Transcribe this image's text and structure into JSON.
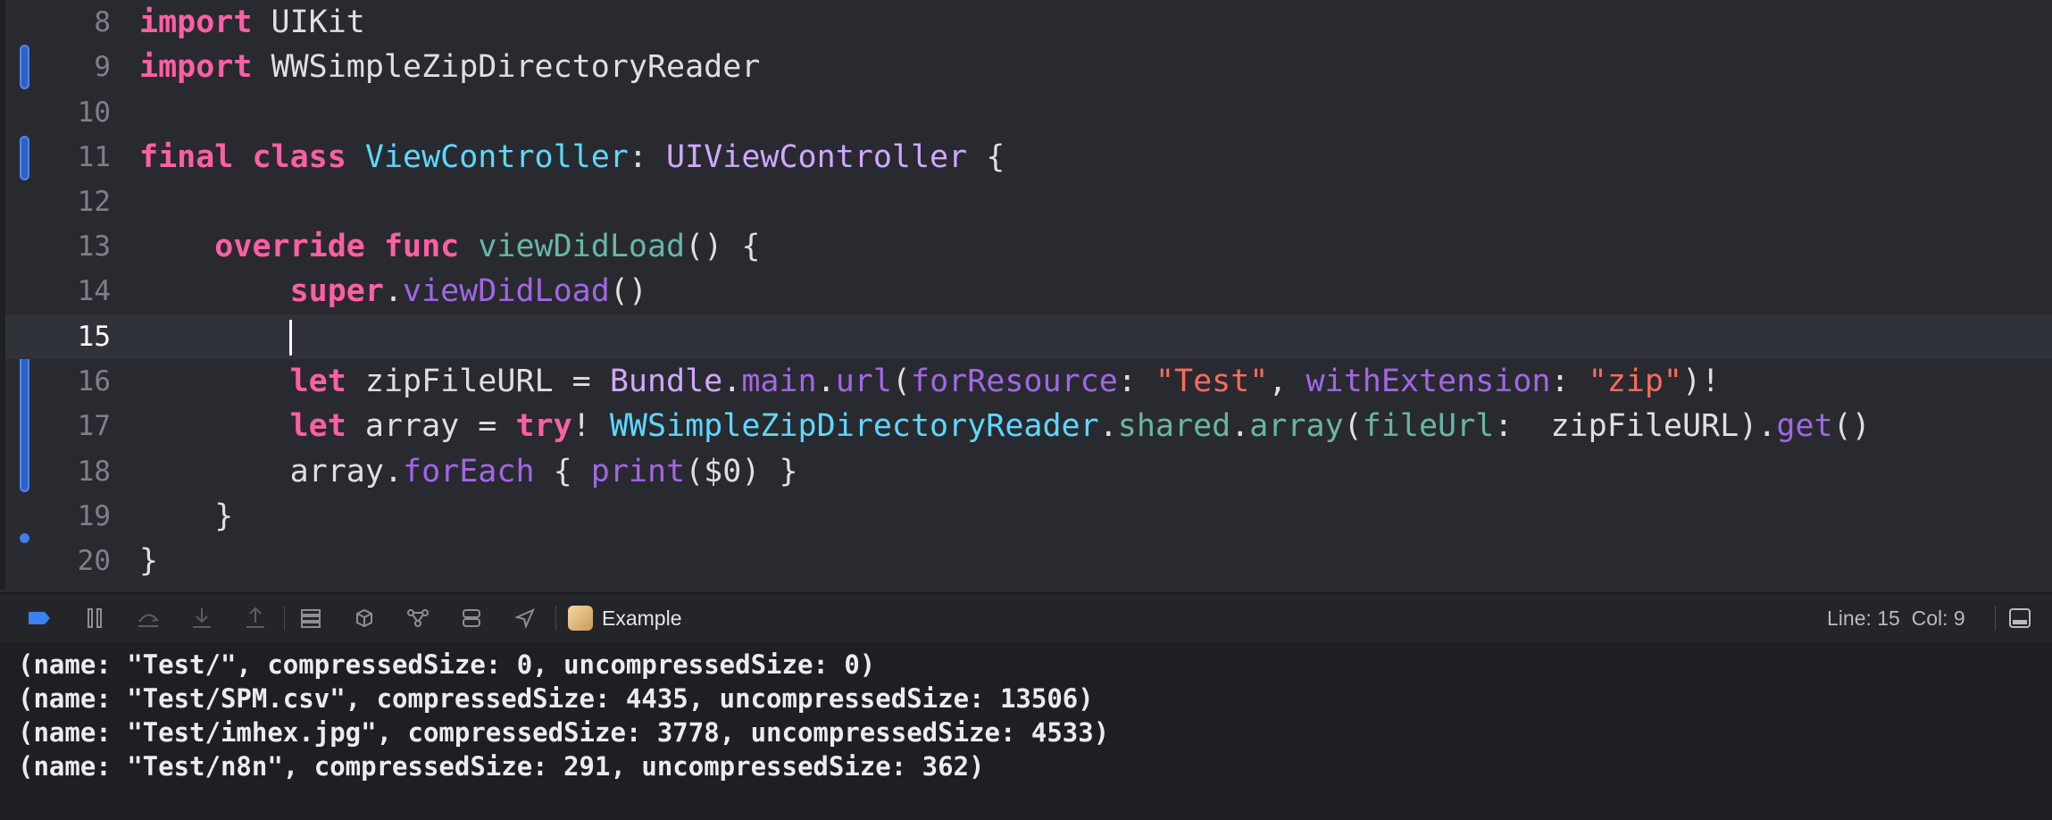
{
  "editor": {
    "lines": [
      {
        "num": "8"
      },
      {
        "num": "9"
      },
      {
        "num": "10"
      },
      {
        "num": "11"
      },
      {
        "num": "12"
      },
      {
        "num": "13"
      },
      {
        "num": "14"
      },
      {
        "num": "15"
      },
      {
        "num": "16"
      },
      {
        "num": "17"
      },
      {
        "num": "18"
      },
      {
        "num": "19"
      },
      {
        "num": "20"
      }
    ],
    "tokens": {
      "import": "import",
      "uikit": "UIKit",
      "reader_module": "WWSimpleZipDirectoryReader",
      "final": "final",
      "class": "class",
      "view_controller": "ViewController",
      "colon": ": ",
      "ui_view_controller": "UIViewController",
      "open_brace": " {",
      "override": "override",
      "func": "func",
      "view_did_load": "viewDidLoad",
      "parens_brace": "() {",
      "super": "super",
      "dot": ".",
      "parens": "()",
      "let": "let",
      "zip_file_url_decl": " zipFileURL = ",
      "bundle": "Bundle",
      "main": "main",
      "url": "url",
      "lparen": "(",
      "for_resource": "forResource",
      "test_str": "\"Test\"",
      "comma": ", ",
      "with_extension": "withExtension",
      "zip_str": "\"zip\"",
      "rparen_bang": ")!",
      "array_decl": " array = ",
      "try": "try",
      "bang_space": "! ",
      "shared": "shared",
      "array_fn": "array",
      "file_url": "fileUrl",
      "zip_file_url": " zipFileURL",
      "rparen_dot": ").",
      "get": "get",
      "array_var": "array",
      "for_each": "forEach",
      "for_each_open": " { ",
      "print": "print",
      "print_arg": "($0) }",
      "close_brace": "}"
    }
  },
  "toolbar": {
    "scheme_name": "Example",
    "position": "Line: 15  Col: 9",
    "icons": [
      "breakpoints-icon",
      "pause-icon",
      "step-over-icon",
      "step-into-icon",
      "step-out-icon",
      "view-hierarchy-icon",
      "memory-graph-icon",
      "environment-icon",
      "simulate-location-icon",
      "location-icon",
      "toggle-console-icon"
    ]
  },
  "console": {
    "lines": [
      "(name: \"Test/\", compressedSize: 0, uncompressedSize: 0)",
      "(name: \"Test/SPM.csv\", compressedSize: 4435, uncompressedSize: 13506)",
      "(name: \"Test/imhex.jpg\", compressedSize: 3778, uncompressedSize: 4533)",
      "(name: \"Test/n8n\", compressedSize: 291, uncompressedSize: 362)"
    ]
  },
  "colors": {
    "background": "#292a30",
    "keyword": "#fc5fa3",
    "type": "#5dd8ff",
    "project_type": "#d0a8ff",
    "string": "#fc6a5d",
    "change_bar": "#2f62c9"
  }
}
